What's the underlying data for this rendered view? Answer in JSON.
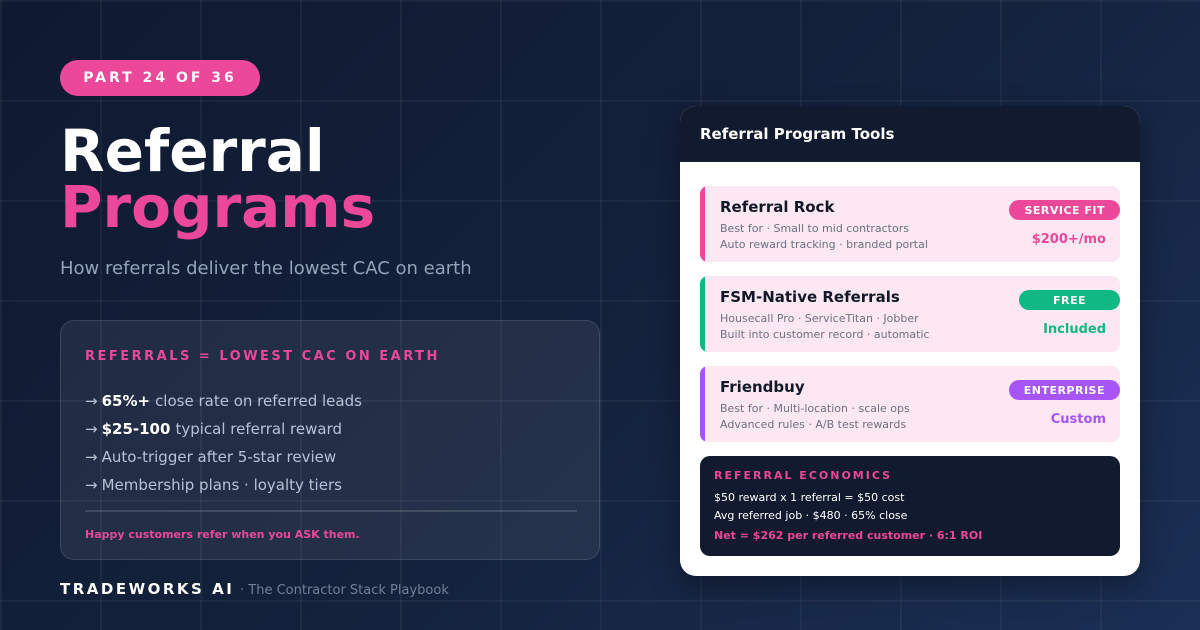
{
  "colors": {
    "accent": "#ec4899",
    "green": "#10b981",
    "purple": "#a855f7",
    "dark": "#111a2e"
  },
  "hero": {
    "part_label": "PART 24 OF 36",
    "title_line1": "Referral",
    "title_line2": "Programs",
    "subtitle": "How referrals deliver the lowest CAC on earth"
  },
  "panel": {
    "heading": "REFERRALS = LOWEST CAC ON EARTH",
    "bullets": [
      {
        "arrow": "→",
        "strong": "65%+",
        "text": "close rate on referred leads"
      },
      {
        "arrow": "→",
        "strong": "$25-100",
        "text": "typical referral reward"
      },
      {
        "arrow": "→",
        "strong": "",
        "text": "Auto-trigger after 5-star review"
      },
      {
        "arrow": "→",
        "strong": "",
        "text": "Membership plans · loyalty tiers"
      }
    ],
    "footer": "Happy customers refer when you ASK them."
  },
  "brand": {
    "name": "TRADEWORKS AI",
    "tagline": "· The Contractor Stack Playbook"
  },
  "card": {
    "title": "Referral Program Tools",
    "tools": [
      {
        "name": "Referral Rock",
        "line1": "Best for · Small to mid contractors",
        "line2": "Auto reward tracking · branded portal",
        "badge": "SERVICE FIT",
        "price": "$200+/mo",
        "color": "#ec4899"
      },
      {
        "name": "FSM-Native Referrals",
        "line1": "Housecall Pro · ServiceTitan · Jobber",
        "line2": "Built into customer record · automatic",
        "badge": "FREE",
        "price": "Included",
        "color": "#10b981"
      },
      {
        "name": "Friendbuy",
        "line1": "Best for · Multi-location · scale ops",
        "line2": "Advanced rules · A/B test rewards",
        "badge": "ENTERPRISE",
        "price": "Custom",
        "color": "#a855f7"
      }
    ],
    "economics": {
      "heading": "REFERRAL ECONOMICS",
      "line1": "$50 reward x 1 referral = $50 cost",
      "line2": "Avg referred job · $480 · 65% close",
      "line3": "Net = $262 per referred customer · 6:1 ROI"
    }
  }
}
